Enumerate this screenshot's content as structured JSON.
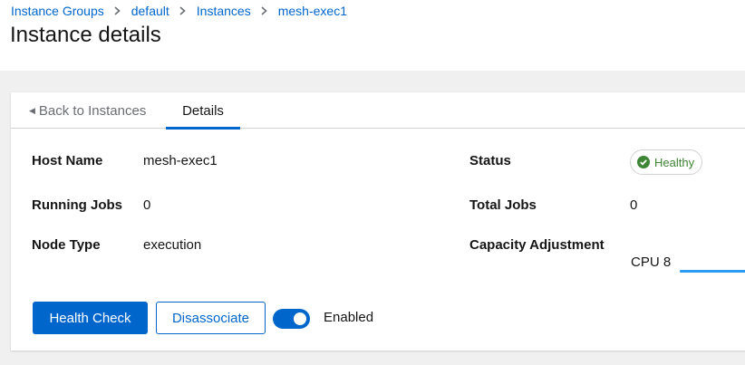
{
  "breadcrumb": {
    "items": [
      "Instance Groups",
      "default",
      "Instances",
      "mesh-exec1"
    ]
  },
  "page_title": "Instance details",
  "tabs": {
    "back_label": "Back to Instances",
    "details_label": "Details"
  },
  "details": {
    "host_name_label": "Host Name",
    "host_name_value": "mesh-exec1",
    "status_label": "Status",
    "status_value": "Healthy",
    "running_jobs_label": "Running Jobs",
    "running_jobs_value": "0",
    "total_jobs_label": "Total Jobs",
    "total_jobs_value": "0",
    "node_type_label": "Node Type",
    "node_type_value": "execution",
    "capacity_label": "Capacity Adjustment",
    "capacity_value": "CPU 8"
  },
  "actions": {
    "health_check_label": "Health Check",
    "disassociate_label": "Disassociate",
    "enabled_label": "Enabled",
    "enabled_state": true
  },
  "colors": {
    "link": "#0066cc",
    "primary": "#0066cc",
    "success": "#3e8635",
    "slider": "#2b9af3"
  },
  "icons": {
    "breadcrumb_separator": "chevron-right-icon",
    "back": "caret-left-icon",
    "status": "check-circle-icon"
  }
}
